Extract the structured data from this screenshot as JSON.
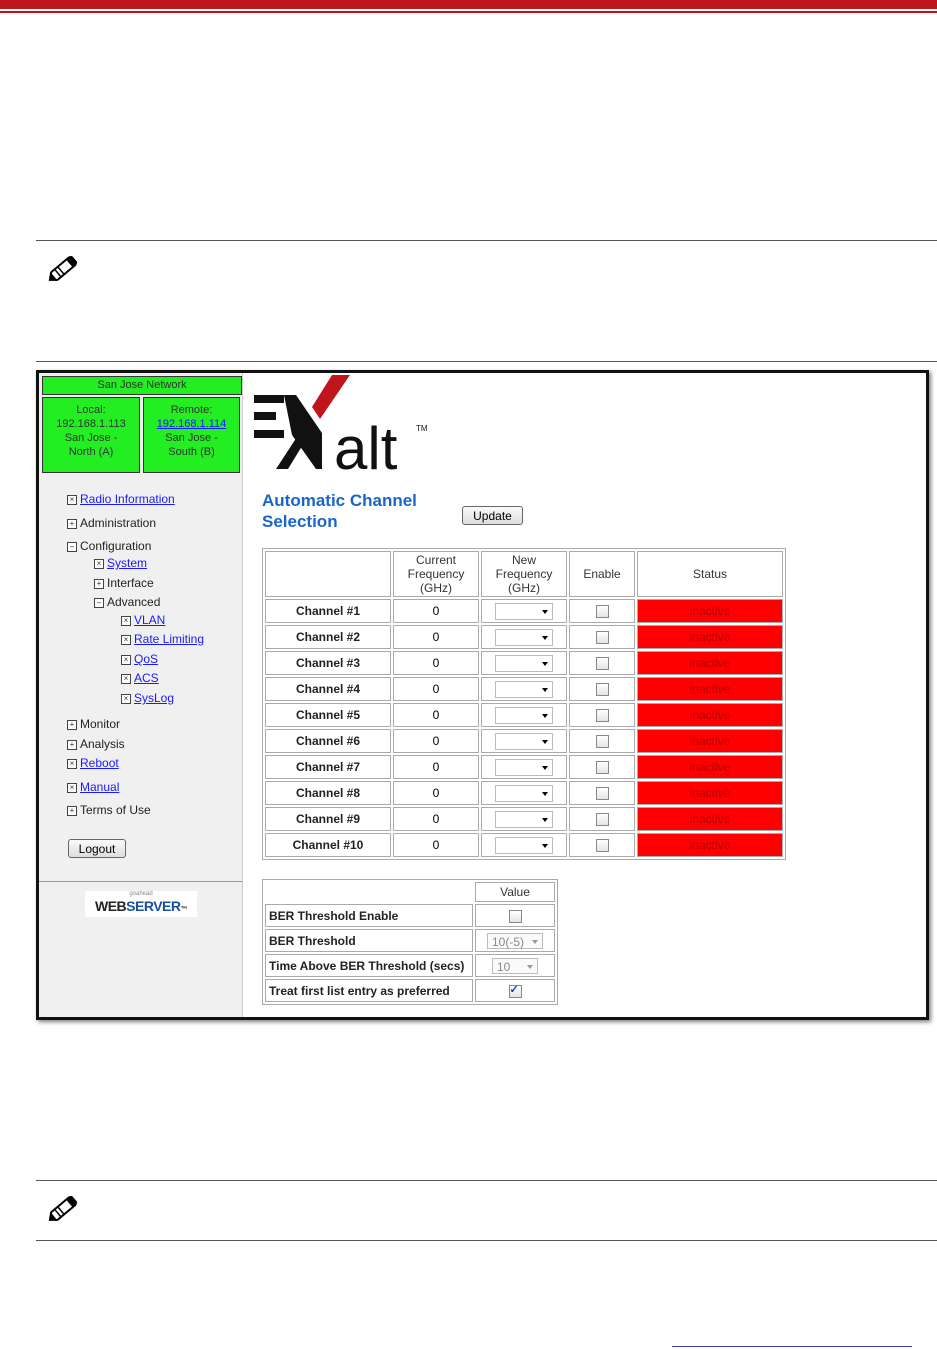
{
  "network": {
    "name": "San Jose Network",
    "local": {
      "label": "Local:",
      "ip": "192.168.1.113",
      "site1": "San Jose -",
      "site2": "North (A)"
    },
    "remote": {
      "label": "Remote:",
      "ip": "192.168.1.114",
      "site1": "San Jose -",
      "site2": "South (B)"
    }
  },
  "nav": {
    "radio_information": "Radio Information",
    "administration": "Administration",
    "configuration": "Configuration",
    "system": "System",
    "interface": "Interface",
    "advanced": "Advanced",
    "vlan": "VLAN",
    "rate_limiting": "Rate Limiting",
    "qos": "QoS",
    "acs": "ACS",
    "syslog": "SysLog",
    "monitor": "Monitor",
    "analysis": "Analysis",
    "reboot": "Reboot",
    "manual": "Manual",
    "terms": "Terms of Use",
    "logout": "Logout"
  },
  "webserver": {
    "small": "goahead",
    "web": "WEB",
    "server": "SERVER",
    "tm": "™"
  },
  "logo": {
    "text": "alt",
    "tm": "TM"
  },
  "acs": {
    "title_line1": "Automatic Channel",
    "title_line2": "Selection",
    "update_label": "Update",
    "headers": {
      "current_l1": "Current",
      "current_l2": "Frequency",
      "current_l3": "(GHz)",
      "new_l1": "New",
      "new_l2": "Frequency",
      "new_l3": "(GHz)",
      "enable": "Enable",
      "status": "Status"
    },
    "channels": [
      {
        "name": "Channel #1",
        "current": "0",
        "status": "inactive"
      },
      {
        "name": "Channel #2",
        "current": "0",
        "status": "inactive"
      },
      {
        "name": "Channel #3",
        "current": "0",
        "status": "inactive"
      },
      {
        "name": "Channel #4",
        "current": "0",
        "status": "inactive"
      },
      {
        "name": "Channel #5",
        "current": "0",
        "status": "inactive"
      },
      {
        "name": "Channel #6",
        "current": "0",
        "status": "inactive"
      },
      {
        "name": "Channel #7",
        "current": "0",
        "status": "inactive"
      },
      {
        "name": "Channel #8",
        "current": "0",
        "status": "inactive"
      },
      {
        "name": "Channel #9",
        "current": "0",
        "status": "inactive"
      },
      {
        "name": "Channel #10",
        "current": "0",
        "status": "inactive"
      }
    ]
  },
  "ber": {
    "value_header": "Value",
    "threshold_enable": "BER Threshold Enable",
    "threshold": "BER Threshold",
    "threshold_value": "10(-5)",
    "time_above": "Time Above BER Threshold (secs)",
    "time_value": "10",
    "preferred": "Treat first list entry as preferred"
  },
  "colors": {
    "accent_red": "#c0151b",
    "node_green": "#22ee22",
    "status_red": "#ff0000",
    "title_blue": "#1a66c8"
  }
}
